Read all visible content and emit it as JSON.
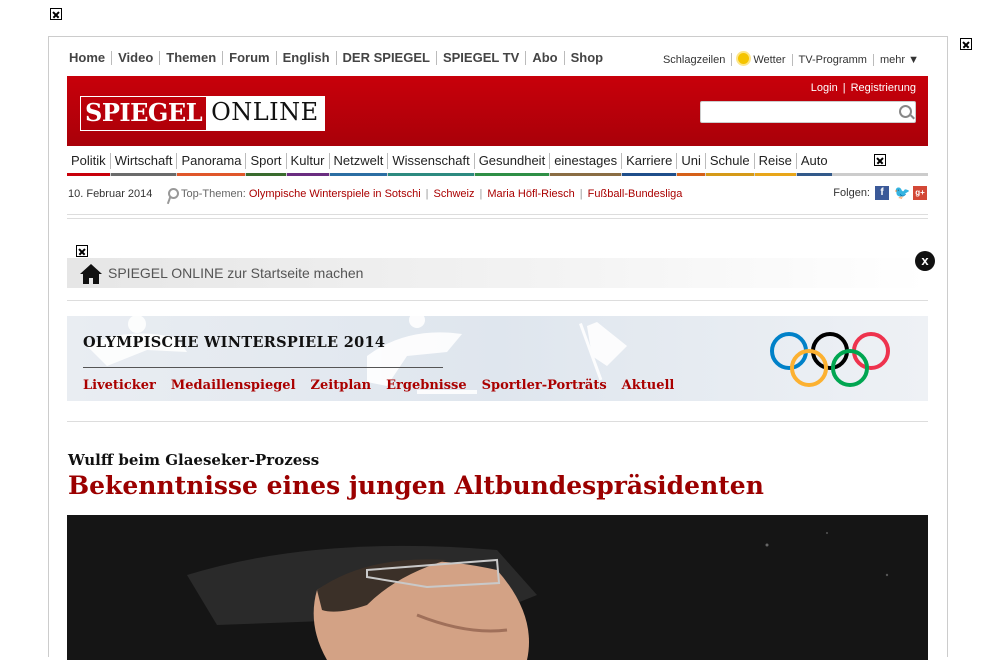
{
  "top_nav": [
    "Home",
    "Video",
    "Themen",
    "Forum",
    "English",
    "DER SPIEGEL",
    "SPIEGEL TV",
    "Abo",
    "Shop"
  ],
  "tools": {
    "schlagzeilen": "Schlagzeilen",
    "wetter": "Wetter",
    "tv": "TV-Programm",
    "mehr": "mehr ▼"
  },
  "logo": {
    "part1": "SPIEGEL",
    "part2": "ONLINE"
  },
  "auth": {
    "login": "Login",
    "separator": "|",
    "register": "Registrierung"
  },
  "search": {
    "value": ""
  },
  "sections": [
    {
      "label": "Politik",
      "color": "#c8000a"
    },
    {
      "label": "Wirtschaft",
      "color": "#6b6b6b"
    },
    {
      "label": "Panorama",
      "color": "#e0572a"
    },
    {
      "label": "Sport",
      "color": "#3a6b2e"
    },
    {
      "label": "Kultur",
      "color": "#6a2d80"
    },
    {
      "label": "Netzwelt",
      "color": "#2b6ea3"
    },
    {
      "label": "Wissenschaft",
      "color": "#2d8a80"
    },
    {
      "label": "Gesundheit",
      "color": "#2f8f46"
    },
    {
      "label": "einestages",
      "color": "#8a6d44"
    },
    {
      "label": "Karriere",
      "color": "#1f4e8a"
    },
    {
      "label": "Uni",
      "color": "#d56018"
    },
    {
      "label": "Schule",
      "color": "#d59a18"
    },
    {
      "label": "Reise",
      "color": "#e8a61a"
    },
    {
      "label": "Auto",
      "color": "#335a8a"
    }
  ],
  "date": "10. Februar 2014",
  "top_topics": {
    "label": "Top-Themen:",
    "items": [
      "Olympische Winterspiele in Sotschi",
      "Schweiz",
      "Maria Höfl-Riesch",
      "Fußball-Bundesliga"
    ]
  },
  "follow": {
    "label": "Folgen:",
    "icons": [
      "facebook-icon",
      "twitter-icon",
      "google-plus-icon"
    ]
  },
  "startpage_bar": {
    "text": "SPIEGEL ONLINE zur Startseite machen",
    "close": "x"
  },
  "olympia": {
    "title": "OLYMPISCHE WINTERSPIELE 2014",
    "links": [
      "Liveticker",
      "Medaillenspiegel",
      "Zeitplan",
      "Ergebnisse",
      "Sportler-Porträts",
      "Aktuell"
    ]
  },
  "article": {
    "kicker": "Wulff beim Glaeseker-Prozess",
    "title": "Bekenntnisse eines jungen Altbundespräsidenten"
  },
  "colors": {
    "brand_red": "#c8000a",
    "link_red": "#a00000",
    "headline_red": "#9b0000"
  }
}
